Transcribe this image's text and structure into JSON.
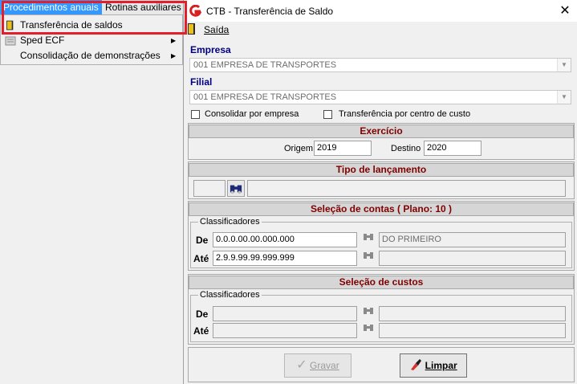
{
  "menu": {
    "procedimentos": "Procedimentos anuais",
    "rotinas": "Rotinas auxiliares",
    "items": [
      {
        "label": "Transferência de saldos",
        "submenu": false
      },
      {
        "label": "Sped ECF",
        "submenu": true
      },
      {
        "label": "Consolidação de demonstrações",
        "submenu": true
      }
    ],
    "submenu_arrow": "▶"
  },
  "window": {
    "title": "CTB - Transferência de Saldo",
    "close": "✕",
    "menubar_saida": "Saída",
    "empresa_label": "Empresa",
    "empresa_value": "001 EMPRESA DE TRANSPORTES",
    "filial_label": "Filial",
    "filial_value": "001 EMPRESA DE TRANSPORTES",
    "consolidar_label": "Consolidar por empresa",
    "transferencia_cc_label": "Transferência por centro de custo",
    "exercicio_title": "Exercício",
    "origem_label": "Origem",
    "origem_value": "2019",
    "destino_label": "Destino",
    "destino_value": "2020",
    "tipo_title": "Tipo de lançamento",
    "contas_title": "Seleção de contas  ( Plano: 10 )",
    "classificadores_label": "Classificadores",
    "de_label": "De",
    "de_value": "0.0.0.00.00.000.000",
    "de_desc": "DO PRIMEIRO",
    "ate_label": "Até",
    "ate_value": "2.9.9.99.99.999.999",
    "custos_title": "Seleção de custos",
    "classificadores2_label": "Classificadores",
    "de2_label": "De",
    "ate2_label": "Até",
    "gravar_label": "Gravar",
    "limpar_label": "Limpar"
  },
  "icons": {
    "binoculars": "🔭",
    "combo_arrow": "▼",
    "check": "✓"
  },
  "colors": {
    "section_title": "#800000",
    "label_blue": "#000080",
    "highlight": "#3399ff",
    "annotation_red": "#e51f2a"
  }
}
